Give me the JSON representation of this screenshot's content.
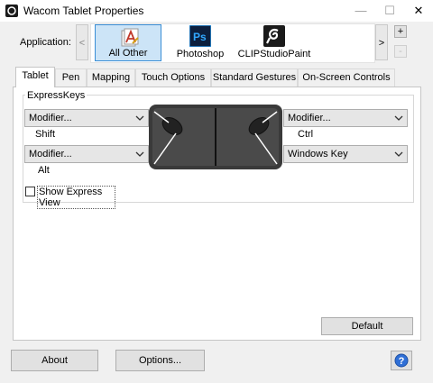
{
  "window": {
    "title": "Wacom Tablet Properties",
    "minimize": "—",
    "maximize": "☐",
    "close": "✕"
  },
  "application": {
    "label": "Application:",
    "scroll_left": "<",
    "scroll_right": ">",
    "apps": [
      {
        "name": "All Other",
        "icon": "all-other-app-icon",
        "selected": true
      },
      {
        "name": "Photoshop",
        "icon": "photoshop-app-icon",
        "selected": false
      },
      {
        "name": "CLIPStudioPaint",
        "icon": "clipstudiopaint-app-icon",
        "selected": false
      }
    ],
    "add": "+",
    "remove": "-"
  },
  "tabs": [
    {
      "label": "Tablet",
      "active": true
    },
    {
      "label": "Pen"
    },
    {
      "label": "Mapping"
    },
    {
      "label": "Touch Options"
    },
    {
      "label": "Standard Gestures"
    },
    {
      "label": "On-Screen Controls"
    }
  ],
  "expresskeys": {
    "group_title": "ExpressKeys",
    "left_top": {
      "value": "Modifier...",
      "sub": "Shift"
    },
    "left_bottom": {
      "value": "Modifier...",
      "sub": "Alt"
    },
    "right_top": {
      "value": "Modifier...",
      "sub": "Ctrl"
    },
    "right_bottom": {
      "value": "Windows Key"
    },
    "show_express_view": "Show Express View",
    "show_express_view_checked": false
  },
  "buttons": {
    "default": "Default",
    "about": "About",
    "options": "Options...",
    "help": "?"
  },
  "colors": {
    "selection_bg": "#cce4f7",
    "selection_border": "#3b8fd6",
    "help_blue": "#2f6fd6",
    "photoshop_bg": "#0c1f3d",
    "photoshop_fg": "#31a8ff"
  }
}
